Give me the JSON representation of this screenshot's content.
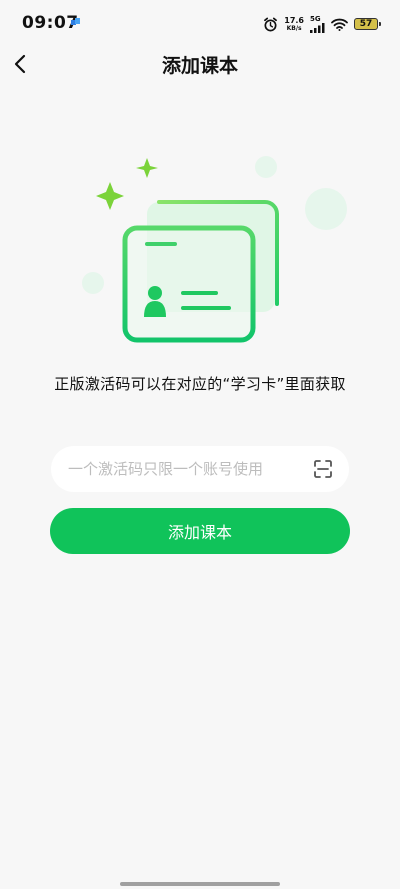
{
  "status_bar": {
    "time": "09:07",
    "net_speed_value": "17.6",
    "net_speed_unit": "KB/s",
    "network_type": "5G",
    "battery_level": "57"
  },
  "nav": {
    "title": "添加课本"
  },
  "main": {
    "description": "正版激活码可以在对应的“学习卡”里面获取",
    "code_input": {
      "value": "",
      "placeholder": "一个激活码只限一个账号使用"
    },
    "submit_label": "添加课本"
  },
  "colors": {
    "accent": "#10c35a",
    "illustration_green": "#32d158",
    "illustration_lime": "#7bd33a"
  },
  "icons": {
    "back": "chevron-left-icon",
    "scan": "scan-icon",
    "alarm": "alarm-icon",
    "signal": "signal-icon",
    "wifi": "wifi-icon",
    "battery": "battery-icon"
  }
}
